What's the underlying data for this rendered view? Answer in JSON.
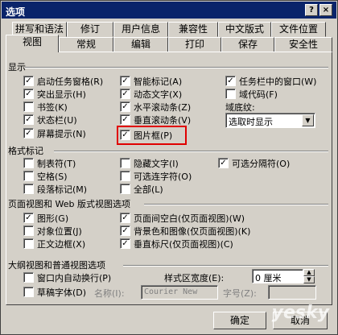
{
  "window": {
    "title": "选项",
    "help": "?",
    "close": "×"
  },
  "tabs_row1": [
    "拼写和语法",
    "修订",
    "用户信息",
    "兼容性",
    "中文版式",
    "文件位置"
  ],
  "tabs_row2": [
    "视图",
    "常规",
    "编辑",
    "打印",
    "保存",
    "安全性"
  ],
  "display": {
    "heading": "显示",
    "col1": [
      {
        "label": "启动任务窗格(R)",
        "checked": true
      },
      {
        "label": "突出显示(H)",
        "checked": true
      },
      {
        "label": "书签(K)",
        "checked": false
      },
      {
        "label": "状态栏(U)",
        "checked": true
      },
      {
        "label": "屏幕提示(N)",
        "checked": true
      }
    ],
    "col2": [
      {
        "label": "智能标记(A)",
        "checked": true
      },
      {
        "label": "动态文字(X)",
        "checked": true
      },
      {
        "label": "水平滚动条(Z)",
        "checked": true
      },
      {
        "label": "垂直滚动条(V)",
        "checked": true
      },
      {
        "label": "图片框(P)",
        "checked": true
      }
    ],
    "col3": [
      {
        "label": "任务栏中的窗口(W)",
        "checked": true
      },
      {
        "label": "域代码(F)",
        "checked": false
      }
    ],
    "shading_label": "域底纹:",
    "shading_value": "选取时显示"
  },
  "format": {
    "heading": "格式标记",
    "col1": [
      {
        "label": "制表符(T)",
        "checked": false
      },
      {
        "label": "空格(S)",
        "checked": false
      },
      {
        "label": "段落标记(M)",
        "checked": false
      }
    ],
    "col2": [
      {
        "label": "隐藏文字(I)",
        "checked": false
      },
      {
        "label": "可选连字符(O)",
        "checked": false
      },
      {
        "label": "全部(L)",
        "checked": false
      }
    ],
    "col3": [
      {
        "label": "可选分隔符(O)",
        "checked": true
      }
    ]
  },
  "pageview": {
    "heading": "页面视图和 Web 版式视图选项",
    "col1": [
      {
        "label": "图形(G)",
        "checked": true
      },
      {
        "label": "对象位置(J)",
        "checked": false
      },
      {
        "label": "正文边框(X)",
        "checked": false
      }
    ],
    "col2": [
      {
        "label": "页面间空白(仅页面视图)(W)",
        "checked": true
      },
      {
        "label": "背景色和图像(仅页面视图)(K)",
        "checked": true
      },
      {
        "label": "垂直标尺(仅页面视图)(C)",
        "checked": true
      }
    ]
  },
  "outline": {
    "heading": "大纲视图和普通视图选项",
    "wrap_label": "窗口内自动换行(P)",
    "draft_label": "草稿字体(D)",
    "name_label": "名称(I):",
    "font_value": "Courier New",
    "style_width_label": "样式区宽度(E):",
    "style_width_value": "0 厘米",
    "size_label": "字号(Z):"
  },
  "buttons": {
    "ok": "确定",
    "cancel": "取消"
  },
  "watermark": "yesky"
}
